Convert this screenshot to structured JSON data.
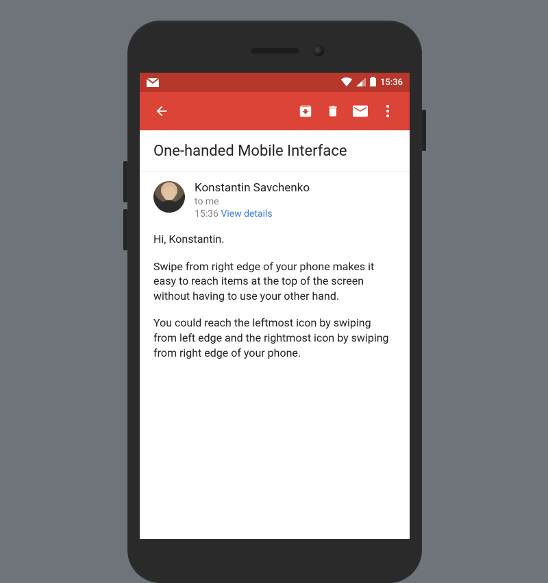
{
  "status": {
    "time": "15:36"
  },
  "email": {
    "subject": "One-handed Mobile Interface",
    "sender": "Konstantin Savchenko",
    "to": "to me",
    "time": "15:36",
    "view_details": "View details",
    "paragraphs": [
      "Hi, Konstantin.",
      "Swipe from right edge of your phone makes it easy to reach items at the top of the screen without having to use your other hand.",
      "You could reach the leftmost icon by swiping from left edge and the rightmost icon by swiping from right edge of your phone."
    ]
  }
}
